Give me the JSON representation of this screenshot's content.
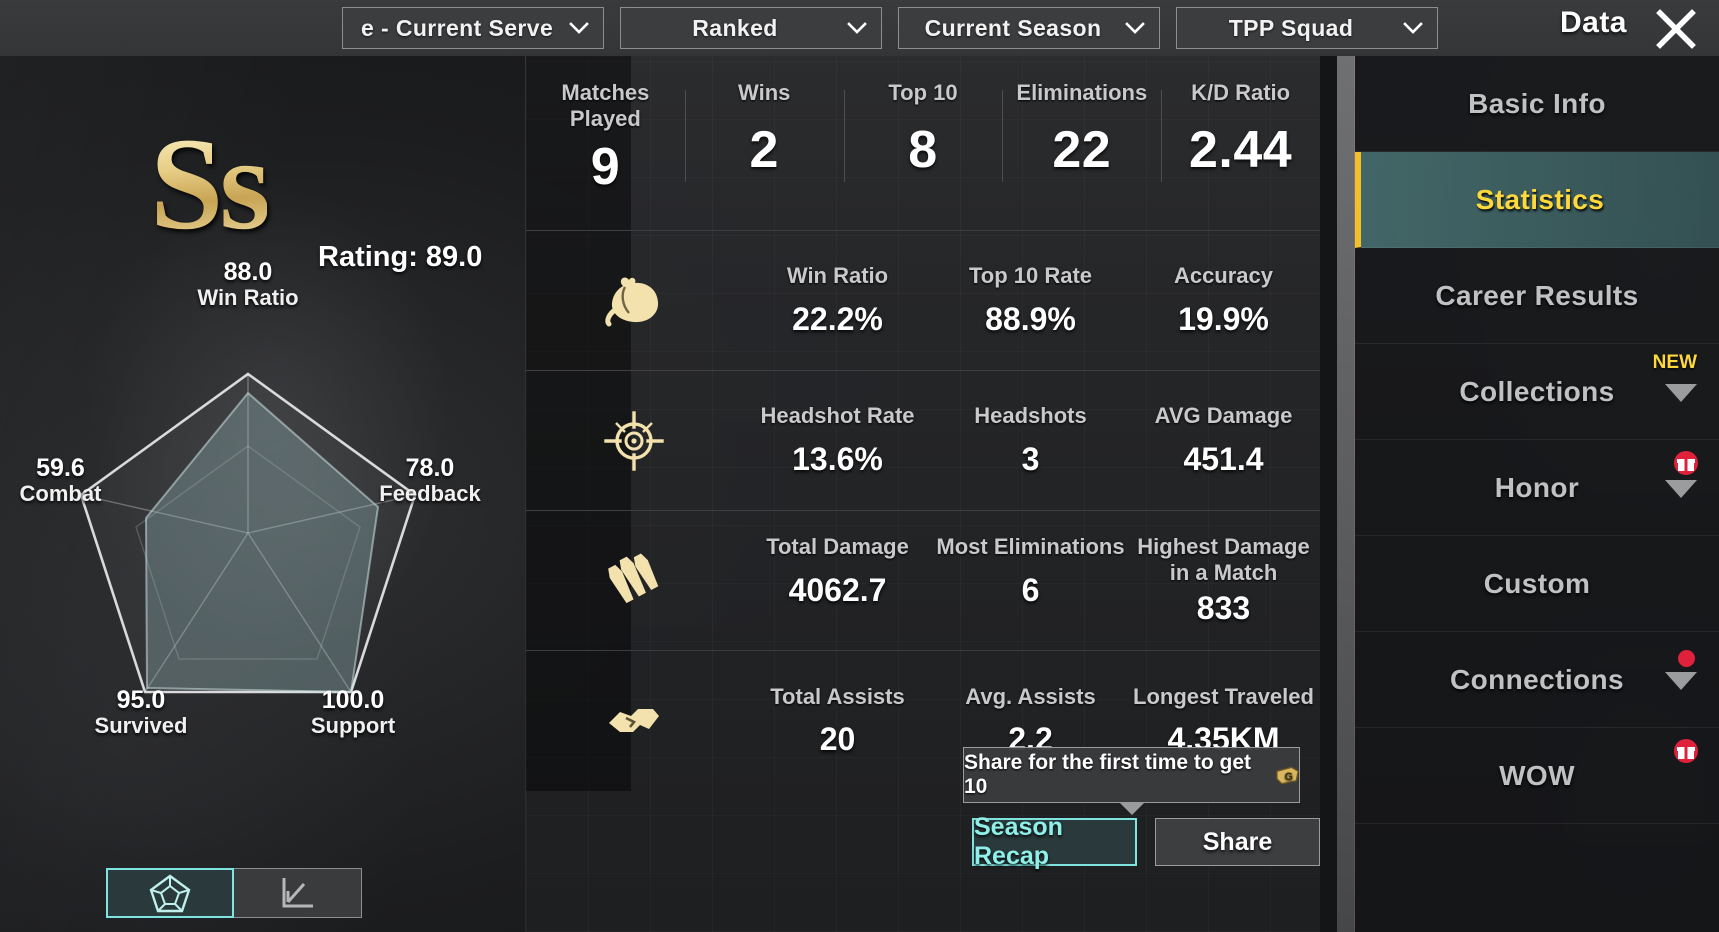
{
  "topbar": {
    "dropdowns": [
      {
        "name": "server",
        "label": "e - Current Serve"
      },
      {
        "name": "mode",
        "label": "Ranked"
      },
      {
        "name": "season",
        "label": "Current Season"
      },
      {
        "name": "team",
        "label": "TPP Squad"
      }
    ],
    "title": "Data",
    "close_icon": "close-icon"
  },
  "left": {
    "rank_badge": "Ss",
    "rating": "Rating: 89.0",
    "toggle": {
      "radar_icon": "pentagon-radar-icon",
      "line_icon": "line-chart-icon"
    }
  },
  "chart_data": {
    "type": "radar",
    "title": "Rating: 89.0",
    "categories": [
      "Win Ratio",
      "Feedback",
      "Support",
      "Survived",
      "Combat"
    ],
    "values": [
      88.0,
      78.0,
      100.0,
      95.0,
      59.6
    ],
    "labels": [
      "88.0",
      "78.0",
      "100.0",
      "95.0",
      "59.6"
    ],
    "ylim": [
      0,
      100
    ],
    "grid": true,
    "legend": "none"
  },
  "summary": [
    {
      "label": "Matches\nPlayed",
      "value": "9"
    },
    {
      "label": "Wins",
      "value": "2"
    },
    {
      "label": "Top 10",
      "value": "8"
    },
    {
      "label": "Eliminations",
      "value": "22"
    },
    {
      "label": "K/D Ratio",
      "value": "2.44"
    }
  ],
  "stat_rows": [
    {
      "icon": "chicken-dinner-icon",
      "cells": [
        {
          "label": "Win Ratio",
          "value": "22.2%"
        },
        {
          "label": "Top 10 Rate",
          "value": "88.9%"
        },
        {
          "label": "Accuracy",
          "value": "19.9%"
        }
      ]
    },
    {
      "icon": "crosshair-icon",
      "cells": [
        {
          "label": "Headshot Rate",
          "value": "13.6%"
        },
        {
          "label": "Headshots",
          "value": "3"
        },
        {
          "label": "AVG Damage",
          "value": "451.4"
        }
      ]
    },
    {
      "icon": "bullets-icon",
      "cells": [
        {
          "label": "Total Damage",
          "value": "4062.7"
        },
        {
          "label": "Most Eliminations",
          "value": "6"
        },
        {
          "label": "Highest Damage in a Match",
          "value": "833"
        }
      ]
    },
    {
      "icon": "handshake-icon",
      "cells": [
        {
          "label": "Total Assists",
          "value": "20"
        },
        {
          "label": "Avg. Assists",
          "value": "2.2"
        },
        {
          "label": "Longest Traveled",
          "value": "4.35KM"
        }
      ]
    }
  ],
  "share_tip": {
    "text": "Share for the first time to get 10",
    "coin_icon": "g-coin-icon"
  },
  "bottom_buttons": [
    {
      "name": "season-recap",
      "label": "Season Recap"
    },
    {
      "name": "share",
      "label": "Share"
    }
  ],
  "sidebar": [
    {
      "name": "basic-info",
      "label": "Basic Info",
      "active": false,
      "caret": false,
      "badge": "none"
    },
    {
      "name": "statistics",
      "label": "Statistics",
      "active": true,
      "caret": false,
      "badge": "none"
    },
    {
      "name": "career-results",
      "label": "Career Results",
      "active": false,
      "caret": false,
      "badge": "none"
    },
    {
      "name": "collections",
      "label": "Collections",
      "active": false,
      "caret": true,
      "badge": "new",
      "badge_text": "NEW"
    },
    {
      "name": "honor",
      "label": "Honor",
      "active": false,
      "caret": true,
      "badge": "gift"
    },
    {
      "name": "custom",
      "label": "Custom",
      "active": false,
      "caret": false,
      "badge": "none"
    },
    {
      "name": "connections",
      "label": "Connections",
      "active": false,
      "caret": true,
      "badge": "dot"
    },
    {
      "name": "wow",
      "label": "WOW",
      "active": false,
      "caret": false,
      "badge": "gift"
    }
  ],
  "colors": {
    "accent_teal": "#7fe3e0",
    "accent_yellow": "#ffd93b",
    "gold": "#e7cd86",
    "red_badge": "#e0213b",
    "panel_bg": "#2c2d2f"
  }
}
